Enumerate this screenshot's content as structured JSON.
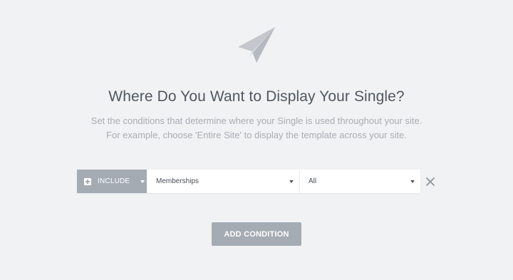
{
  "header": {
    "icon": "paper-plane-icon",
    "title": "Where Do You Want to Display Your Single?",
    "description_line1": "Set the conditions that determine where your Single is used throughout your site.",
    "description_line2": "For example, choose 'Entire Site' to display the template across your site."
  },
  "condition": {
    "type_icon": "plus-square-icon",
    "type_label": "INCLUDE",
    "main_value": "Memberships",
    "sub_value": "All",
    "remove_icon": "close-icon"
  },
  "actions": {
    "add_condition_label": "ADD CONDITION"
  },
  "colors": {
    "background": "#f1f2f3",
    "accent_gray": "#a4abb3",
    "title_text": "#50575f",
    "description_text": "#a8adb2"
  }
}
